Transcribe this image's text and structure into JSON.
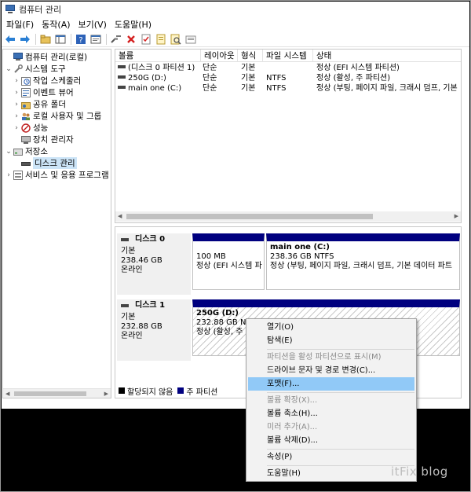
{
  "window": {
    "title": "컴퓨터 관리"
  },
  "menubar": {
    "items": [
      "파일(F)",
      "동작(A)",
      "보기(V)",
      "도움말(H)"
    ]
  },
  "toolbar": {
    "buttons": [
      "back-arrow-icon",
      "forward-arrow-icon",
      "up-folder-icon",
      "show-hide-tree-icon",
      "help-icon",
      "properties-icon",
      "connect-icon",
      "delete-x-icon",
      "checklist-icon",
      "export-icon",
      "search-icon",
      "magnifier-icon"
    ]
  },
  "tree": {
    "items": [
      {
        "label": "컴퓨터 관리(로컬)",
        "icon": "computer-icon",
        "expander": ""
      },
      {
        "label": "시스템 도구",
        "icon": "tools-icon",
        "expander": "⌄"
      },
      {
        "label": "작업 스케줄러",
        "icon": "clock-icon",
        "expander": "›"
      },
      {
        "label": "이벤트 뷰어",
        "icon": "event-viewer-icon",
        "expander": "›"
      },
      {
        "label": "공유 폴더",
        "icon": "shared-folder-icon",
        "expander": "›"
      },
      {
        "label": "로컬 사용자 및 그룹",
        "icon": "users-icon",
        "expander": "›"
      },
      {
        "label": "성능",
        "icon": "performance-icon",
        "expander": "›"
      },
      {
        "label": "장치 관리자",
        "icon": "device-manager-icon",
        "expander": ""
      },
      {
        "label": "저장소",
        "icon": "storage-icon",
        "expander": "⌄"
      },
      {
        "label": "디스크 관리",
        "icon": "disk-icon",
        "expander": ""
      },
      {
        "label": "서비스 및 응용 프로그램",
        "icon": "services-icon",
        "expander": "›"
      }
    ]
  },
  "volume_list": {
    "columns": [
      "볼륨",
      "레이아웃",
      "형식",
      "파일 시스템",
      "상태"
    ],
    "rows": [
      {
        "volume": "(디스크 0 파티션 1)",
        "layout": "단순",
        "type": "기본",
        "fs": "",
        "status": "정상 (EFI 시스템 파티션)"
      },
      {
        "volume": "250G (D:)",
        "layout": "단순",
        "type": "기본",
        "fs": "NTFS",
        "status": "정상 (활성, 주 파티션)"
      },
      {
        "volume": "main one (C:)",
        "layout": "단순",
        "type": "기본",
        "fs": "NTFS",
        "status": "정상 (부팅, 페이지 파일, 크래시 덤프, 기본"
      }
    ]
  },
  "disks": [
    {
      "name": "디스크 0",
      "type": "기본",
      "size": "238.46 GB",
      "status": "온라인",
      "partitions": [
        {
          "title": "",
          "size": "100 MB",
          "status": "정상 (EFI 시스템 파"
        },
        {
          "title": "main one  (C:)",
          "size": "238.36 GB NTFS",
          "status": "정상 (부팅, 페이지 파일, 크래시 덤프, 기본 데이터 파트"
        }
      ]
    },
    {
      "name": "디스크 1",
      "type": "기본",
      "size": "232.88 GB",
      "status": "온라인",
      "partitions": [
        {
          "title": "250G  (D:)",
          "size": "232.88 GB NTF",
          "status": "정상 (활성, 주"
        }
      ]
    }
  ],
  "legend": {
    "items": [
      {
        "label": "할당되지 않음",
        "color": "#000000"
      },
      {
        "label": "주 파티션",
        "color": "#00007f"
      }
    ]
  },
  "context_menu": {
    "items": [
      {
        "label": "열기(O)",
        "disabled": false
      },
      {
        "label": "탐색(E)",
        "disabled": false
      },
      {
        "label": "파티션을 활성 파티션으로 표시(M)",
        "disabled": true
      },
      {
        "label": "드라이브 문자 및 경로 변경(C)...",
        "disabled": false
      },
      {
        "label": "포맷(F)...",
        "disabled": false,
        "highlighted": true
      },
      {
        "label": "볼륨 확장(X)...",
        "disabled": true
      },
      {
        "label": "볼륨 축소(H)...",
        "disabled": false
      },
      {
        "label": "미러 추가(A)...",
        "disabled": true
      },
      {
        "label": "볼륨 삭제(D)...",
        "disabled": false
      },
      {
        "label": "속성(P)",
        "disabled": false
      },
      {
        "label": "도움말(H)",
        "disabled": false
      }
    ]
  },
  "watermark": "itFix blog",
  "colors": {
    "primary_partition": "#00007f",
    "menu_highlight": "#91c9f7",
    "tree_selection": "#cce4f7"
  }
}
